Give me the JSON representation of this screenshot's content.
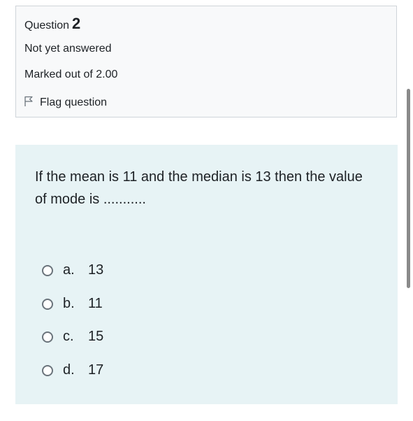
{
  "info": {
    "question_label": "Question",
    "question_number": "2",
    "state": "Not yet answered",
    "grade": "Marked out of 2.00",
    "flag_label": "Flag question"
  },
  "question": {
    "text": "If the mean is 11 and the median is 13 then the value of mode is ..........."
  },
  "options": [
    {
      "letter": "a.",
      "value": "13"
    },
    {
      "letter": "b.",
      "value": "11"
    },
    {
      "letter": "c.",
      "value": "15"
    },
    {
      "letter": "d.",
      "value": "17"
    }
  ],
  "colors": {
    "info_background": "#f8f9fa",
    "content_background": "#e7f3f5",
    "text": "#1d2125"
  }
}
